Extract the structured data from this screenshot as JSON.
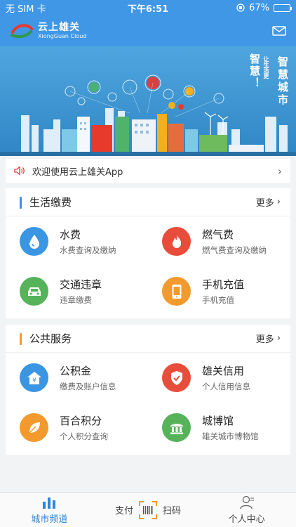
{
  "status_bar": {
    "carrier": "无 SIM 卡",
    "time": "下午6:51",
    "battery_text": "67%",
    "battery_level": 0.67
  },
  "header": {
    "logo_title": "云上雄关",
    "logo_subtitle": "XiongGuan Cloud",
    "mail_icon": "mail-icon"
  },
  "banner": {
    "slogan_main": "智慧城市",
    "slogan_sub": "让生活更",
    "slogan_left": "智慧！"
  },
  "notice": {
    "text": "欢迎使用云上雄关App",
    "icon": "speaker-icon"
  },
  "life_section": {
    "title": "生活缴费",
    "more": "更多",
    "accent": "#3f8fe0",
    "items": [
      {
        "name": "水费",
        "desc": "水费查询及缴纳",
        "icon": "water-drop-icon",
        "color": "#3a95e3"
      },
      {
        "name": "燃气费",
        "desc": "燃气费查询及缴纳",
        "icon": "flame-icon",
        "color": "#e84c3a"
      },
      {
        "name": "交通违章",
        "desc": "违章缴费",
        "icon": "car-icon",
        "color": "#56b35a"
      },
      {
        "name": "手机充值",
        "desc": "手机充值",
        "icon": "phone-icon",
        "color": "#f29a2e"
      }
    ]
  },
  "public_section": {
    "title": "公共服务",
    "more": "更多",
    "accent": "#f29a2e",
    "items": [
      {
        "name": "公积金",
        "desc": "缴费及账户信息",
        "icon": "house-yuan-icon",
        "color": "#3a95e3"
      },
      {
        "name": "雄关信用",
        "desc": "个人信用信息",
        "icon": "shield-check-icon",
        "color": "#e84c3a"
      },
      {
        "name": "百合积分",
        "desc": "个人积分查询",
        "icon": "leaf-icon",
        "color": "#f29a2e"
      },
      {
        "name": "城博馆",
        "desc": "雄关城市博物馆",
        "icon": "museum-icon",
        "color": "#56b35a"
      }
    ]
  },
  "tabbar": {
    "city": "城市频道",
    "pay": "支付",
    "scan": "扫码",
    "me": "个人中心",
    "active_color": "#2f86d6"
  }
}
